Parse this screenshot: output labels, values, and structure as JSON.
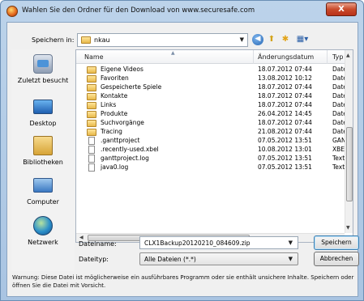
{
  "window": {
    "title": "Wahlen Sie den Ordner für den Download von www.securesafe.com",
    "close_label": "X"
  },
  "toolbar": {
    "lookin_label": "Speichern in:",
    "lookin_value": "nkau",
    "lookin_arrow": "▼",
    "back_icon": "back-arrow-icon",
    "up_icon": "folder-up-icon",
    "new_folder_icon": "new-folder-icon",
    "views_icon": "views-menu-icon"
  },
  "places": [
    {
      "label": "Zuletzt besucht",
      "icon": "recent-places-icon"
    },
    {
      "label": "Desktop",
      "icon": "desktop-icon"
    },
    {
      "label": "Bibliotheken",
      "icon": "libraries-icon"
    },
    {
      "label": "Computer",
      "icon": "computer-icon"
    },
    {
      "label": "Netzwerk",
      "icon": "network-icon"
    }
  ],
  "filelist": {
    "columns": {
      "name": "Name",
      "date": "Änderungsdatum",
      "type": "Typ"
    },
    "rows": [
      {
        "name": "Eigene Videos",
        "date": "18.07.2012 07:44",
        "type": "Dateio",
        "icon": "folder"
      },
      {
        "name": "Favoriten",
        "date": "13.08.2012 10:12",
        "type": "Dateio",
        "icon": "folder"
      },
      {
        "name": "Gespeicherte Spiele",
        "date": "18.07.2012 07:44",
        "type": "Dateio",
        "icon": "folder"
      },
      {
        "name": "Kontakte",
        "date": "18.07.2012 07:44",
        "type": "Dateio",
        "icon": "folder"
      },
      {
        "name": "Links",
        "date": "18.07.2012 07:44",
        "type": "Dateio",
        "icon": "folder"
      },
      {
        "name": "Produkte",
        "date": "26.04.2012 14:45",
        "type": "Dateio",
        "icon": "folder"
      },
      {
        "name": "Suchvorgänge",
        "date": "18.07.2012 07:44",
        "type": "Dateio",
        "icon": "folder"
      },
      {
        "name": "Tracing",
        "date": "21.08.2012 07:44",
        "type": "Dateio",
        "icon": "folder"
      },
      {
        "name": ".ganttproject",
        "date": "07.05.2012 13:51",
        "type": "GANTT",
        "icon": "file"
      },
      {
        "name": ".recently-used.xbel",
        "date": "10.08.2012 13:01",
        "type": "XBEL-D",
        "icon": "file"
      },
      {
        "name": "ganttproject.log",
        "date": "07.05.2012 13:51",
        "type": "Textdo",
        "icon": "file"
      },
      {
        "name": "java0.log",
        "date": "07.05.2012 13:51",
        "type": "Textdo",
        "icon": "file"
      }
    ]
  },
  "form": {
    "filename_label": "Dateiname:",
    "filename_value": "CLX1Backup20120210_084609.zip",
    "filetype_label": "Dateityp:",
    "filetype_value": "Alle Dateien (*.*)",
    "save_label": "Speichern",
    "cancel_label": "Abbrechen"
  },
  "warning": "Warnung: Diese Datei ist möglicherweise ein ausführbares Programm oder sie enthält unsichere Inhalte. Speichern oder öffnen Sie die Datei mit Vorsicht.",
  "colors": {
    "titlebar": "#bcd3ea",
    "close": "#c94a2a",
    "accent": "#3c7fb1"
  }
}
